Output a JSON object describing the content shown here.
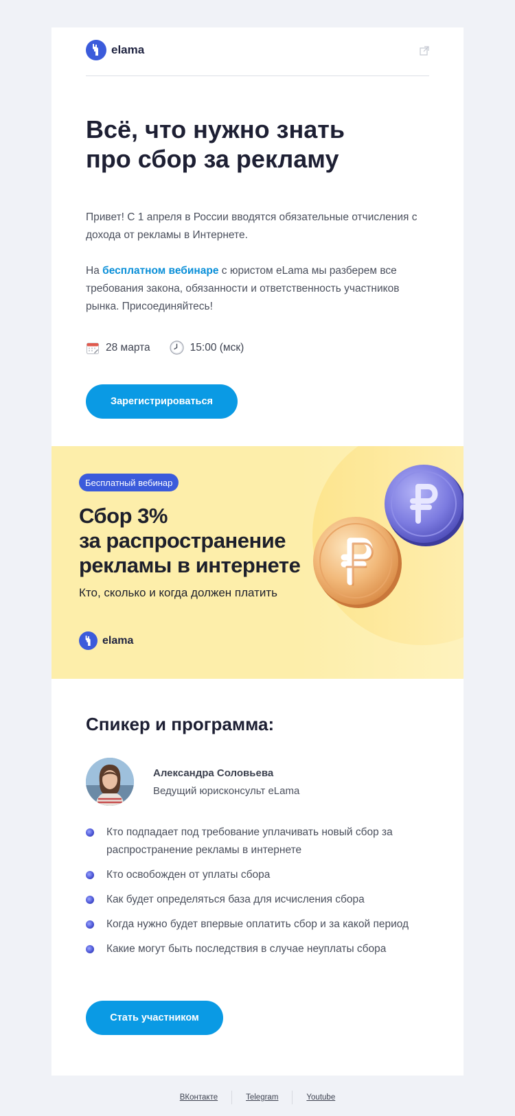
{
  "header": {
    "brand": "elama"
  },
  "hero": {
    "title_line1": "Всё, что нужно знать",
    "title_line2": "про сбор за рекламу",
    "intro": "Привет! С 1 апреля в России вводятся обязательные отчисления с дохода от рекламы в Интернете.",
    "p2_before": "На ",
    "p2_link": "бесплатном вебинаре",
    "p2_after": " с юристом eLama мы разберем все требования закона, обязанности и ответственность участников рынка. Присоединяйтесь!",
    "date": "28 марта",
    "time": "15:00 (мск)",
    "register_button": "Зарегистрироваться"
  },
  "banner": {
    "badge": "Бесплатный вебинар",
    "title_line1": "Сбор 3%",
    "title_line2": "за распространение",
    "title_line3": "рекламы в интернете",
    "subtitle": "Кто, сколько и когда должен платить",
    "brand": "elama"
  },
  "program": {
    "heading": "Спикер и программа:",
    "speaker_name": "Александра Соловьева",
    "speaker_role": "Ведущий юрисконсульт eLama",
    "items": [
      "Кто подпадает под требование уплачивать новый сбор за распространение рекламы в интернете",
      "Кто освобожден от уплаты сбора",
      "Как будет определяться база для исчисления сбора",
      "Когда нужно будет впервые оплатить сбор и за какой период",
      "Какие могут быть последствия в случае неуплаты сбора"
    ],
    "join_button": "Стать участником"
  },
  "footer": {
    "links": [
      "ВКонтакте",
      "Telegram",
      "Youtube"
    ]
  }
}
